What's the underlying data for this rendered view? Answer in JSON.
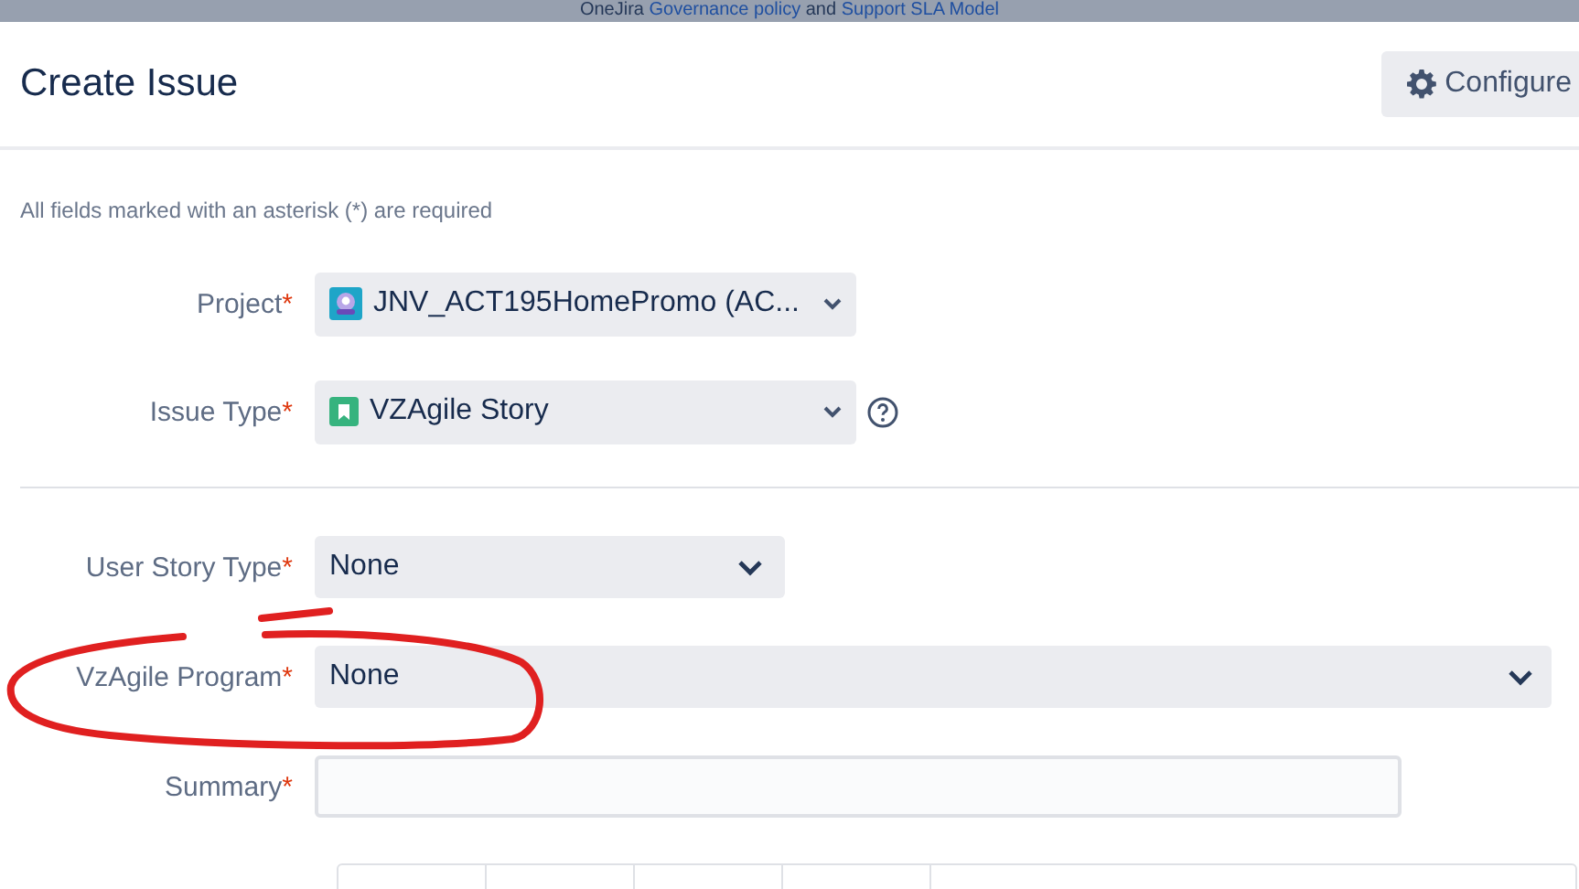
{
  "banner": {
    "prefix": "OneJira ",
    "link_1": "Governance policy",
    "middle": " and ",
    "link_2": "Support SLA Model"
  },
  "dialog": {
    "title": "Create Issue",
    "configure_button": "Configure"
  },
  "required_note": "All fields marked with an asterisk (*) are required",
  "top_fields": [
    {
      "kind": "project",
      "label": "Project",
      "required_mark": "*",
      "value": "JNV_ACT195HomePromo (AC..."
    },
    {
      "kind": "issue_type",
      "label": "Issue Type",
      "required_mark": "*",
      "value": "VZAgile Story"
    }
  ],
  "fields": [
    {
      "kind": "short_select",
      "label": "User Story Type",
      "required_mark": "*",
      "value": "None"
    },
    {
      "kind": "wide_select",
      "label": "VzAgile Program",
      "required_mark": "*",
      "value": "None"
    },
    {
      "kind": "text",
      "label": "Summary",
      "required_mark": "*"
    }
  ]
}
